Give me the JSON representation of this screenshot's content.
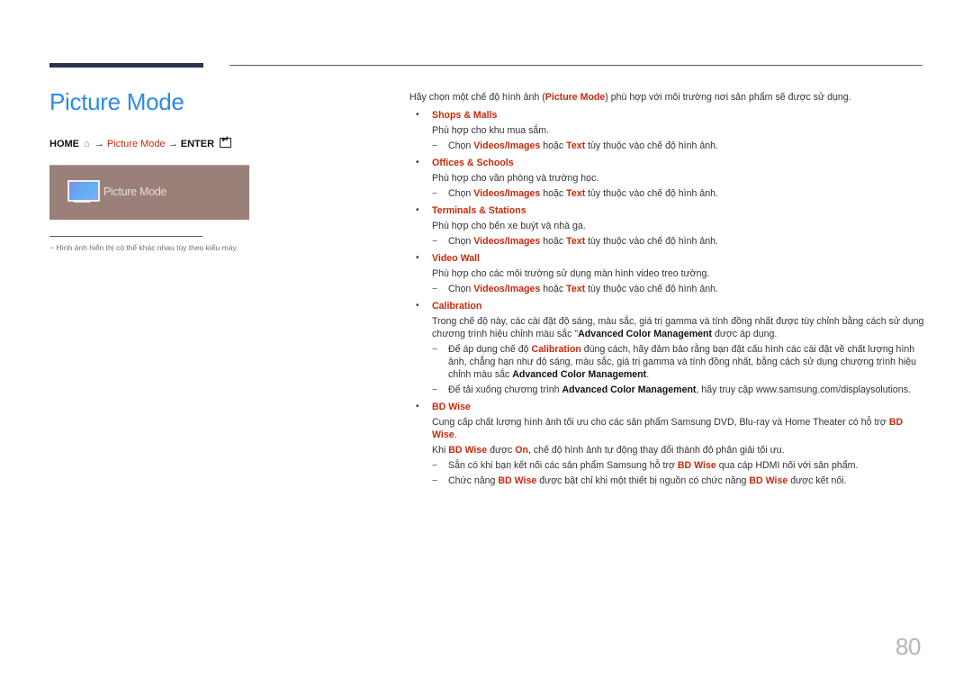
{
  "header": {
    "title": "Picture Mode"
  },
  "nav_path": {
    "home_label": "HOME",
    "home_icon": "home-icon",
    "arrow": "→",
    "picture_mode_label": "Picture Mode",
    "enter_label": "ENTER",
    "enter_icon": "enter-icon"
  },
  "screenshot": {
    "icon": "tv-monitor-icon",
    "label": "Picture Mode"
  },
  "note": {
    "dash": "−",
    "text": "Hình ảnh hiển thị có thể khác nhau tùy theo kiểu máy."
  },
  "intro": {
    "before": "Hãy chọn một chế độ hình ảnh (",
    "highlight": "Picture Mode",
    "after": ") phù hợp với môi trường nơi sản phẩm sẽ được sử dụng."
  },
  "common": {
    "bullet": "•",
    "dash": "−",
    "choose": "Chọn ",
    "videos_images": "Videos/Images",
    "or": " hoặc ",
    "text": "Text",
    "choose_after": " tùy thuộc vào chế độ hình ảnh."
  },
  "items": [
    {
      "title": "Shops & Malls",
      "desc": "Phù hợp cho khu mua sắm."
    },
    {
      "title": "Offices & Schools",
      "desc": "Phù hợp cho văn phòng và trường học."
    },
    {
      "title": "Terminals & Stations",
      "desc": "Phù hợp cho bến xe buýt và nhà ga."
    },
    {
      "title": "Video Wall",
      "desc": "Phù hợp cho các môi trường sử dụng màn hình video treo tường."
    }
  ],
  "calibration": {
    "title": "Calibration",
    "desc_before": "Trong chế độ này, các cài đặt độ sáng, màu sắc, giá trị gamma và tính đồng nhất được tùy chỉnh bằng cách sử dụng chương trình hiệu chỉnh màu sắc \"",
    "desc_bold": "Advanced Color Management",
    "desc_after": " được áp dụng.",
    "sub1_before": "Để áp dụng chế độ ",
    "sub1_red": "Calibration",
    "sub1_middle": " đúng cách, hãy đảm bảo rằng bạn đặt cấu hình các cài đặt về chất lượng hình ảnh, chẳng hạn như độ sáng, màu sắc, giá trị gamma và tính đồng nhất, bằng cách sử dụng chương trình hiệu chỉnh màu sắc ",
    "sub1_bold": "Advanced Color Management",
    "sub1_after": ".",
    "sub2_before": "Để tải xuống chương trình ",
    "sub2_bold": "Advanced Color Management",
    "sub2_after": ", hãy truy cập www.samsung.com/displaysolutions."
  },
  "bdwise": {
    "title": "BD Wise",
    "desc1_before": "Cung cấp chất lượng hình ảnh tối ưu cho các sản phẩm Samsung DVD, Blu-ray và Home Theater có hỗ trợ ",
    "desc1_red": "BD Wise",
    "desc1_after": ".",
    "desc2_before": "Khi ",
    "desc2_red1": "BD Wise",
    "desc2_middle": " được ",
    "desc2_red2": "On",
    "desc2_after": ", chế độ hình ảnh tự động thay đổi thành độ phân giải tối ưu.",
    "sub1_before": "Sẵn có khi bạn kết nối các sản phẩm Samsung hỗ trợ ",
    "sub1_red": "BD Wise",
    "sub1_after": " qua cáp HDMI nối với sản phẩm.",
    "sub2_before": "Chức năng ",
    "sub2_red1": "BD Wise",
    "sub2_middle": " được bật chỉ khi một thiết bị nguồn có chức năng ",
    "sub2_red2": "BD Wise",
    "sub2_after": " được kết nối."
  },
  "page_number": "80",
  "colors": {
    "title_blue": "#2b8ae8",
    "highlight_red": "#c8290b",
    "header_bar": "#2b3351"
  }
}
